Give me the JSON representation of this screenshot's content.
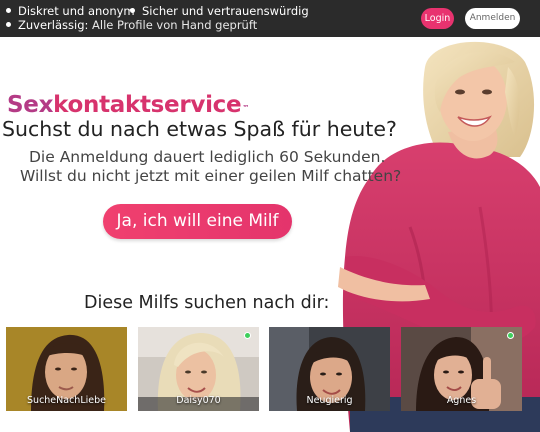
{
  "topbar": {
    "features": [
      {
        "label": "Diskret und anonym",
        "detail": ""
      },
      {
        "label": "Sicher und vertrauenswürdig",
        "detail": ""
      },
      {
        "label": "Zuverlässig:",
        "detail": "Alle Profile von Hand geprüft"
      }
    ],
    "login_label": "Login",
    "register_label": "Anmelden"
  },
  "hero": {
    "logo_part1": "Sex",
    "logo_part2": "kontaktservice",
    "logo_tm": "™",
    "headline": "Suchst du nach etwas Spaß für heute?",
    "sub_line1": "Die Anmeldung dauert lediglich 60 Sekunden.",
    "sub_line2": "Willst du nicht jetzt mit einer geilen Milf chatten?",
    "cta_label": "Ja, ich will eine Milf"
  },
  "profiles": {
    "title": "Diese Milfs suchen nach dir:",
    "items": [
      {
        "name": "SucheNachLiebe",
        "online": false
      },
      {
        "name": "Daisy070",
        "online": true
      },
      {
        "name": "Neugierig",
        "online": false
      },
      {
        "name": "Agnes",
        "online": true
      }
    ]
  },
  "colors": {
    "topbar_bg": "#2b2b2b",
    "accent": "#e8336f",
    "logo_purple": "#b43b86",
    "online": "#3ecf5c"
  }
}
